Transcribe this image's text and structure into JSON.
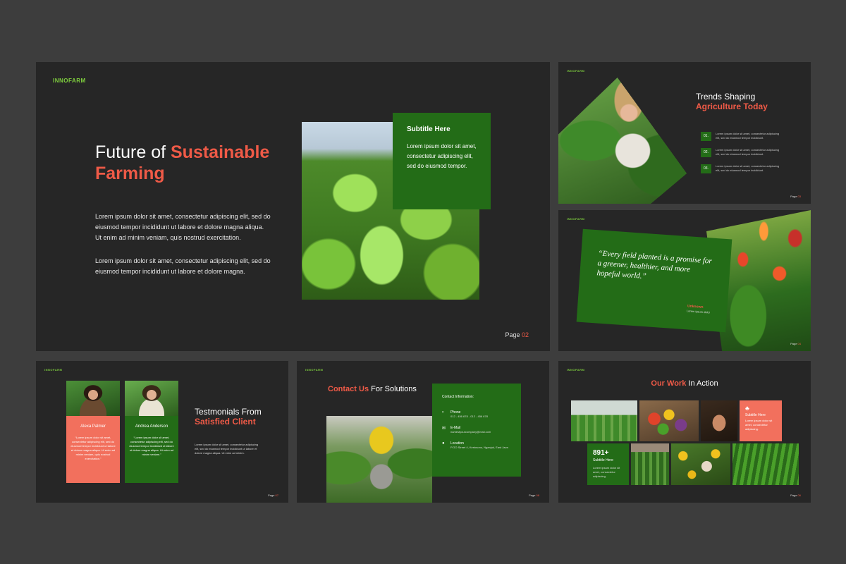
{
  "brand": "INNOFARM",
  "slide1": {
    "title_a": "Future of ",
    "title_b": "Sustainable",
    "title_c": "Farming",
    "para1": "Lorem ipsum dolor sit amet, consectetur adipiscing elit, sed do eiusmod tempor incididunt ut labore et dolore magna aliqua. Ut enim ad minim veniam, quis nostrud exercitation.",
    "para2": "Lorem ipsum dolor sit amet, consectetur adipiscing elit, sed do eiusmod tempor incididunt ut labore et dolore magna.",
    "box_title": "Subtitle Here",
    "box_text": "Lorem ipsum dolor sit amet, consectetur adipiscing elit, sed do eiusmod tempor.",
    "page_label": "Page ",
    "page_num": "02"
  },
  "slide2": {
    "title_a": "Trends Shaping",
    "title_b": "Agriculture Today",
    "items": [
      {
        "num": "01.",
        "text": "Lorem ipsum dolor sit amet, consectetur adipiscing elit, sed do eiusmod tempor incididunt."
      },
      {
        "num": "02.",
        "text": "Lorem ipsum dolor sit amet, consectetur adipiscing elit, sed do eiusmod tempor incididunt."
      },
      {
        "num": "03.",
        "text": "Lorem ipsum dolor sit amet, consectetur adipiscing elit, sed do eiusmod tempor incididunt."
      }
    ],
    "page_label": "Page ",
    "page_num": "03"
  },
  "slide3": {
    "quote": "“Every field planted is a promise for a greener, healthier, and more hopeful world.”",
    "author": "Unknown",
    "author_sub": "Lorem ipsum dolor",
    "page_label": "Page ",
    "page_num": "04"
  },
  "slide4": {
    "title_a": "Testmonials From",
    "title_b": "Satisfied Client",
    "text": "Lorem ipsum dolor sit amet, consectetur adipiscing elit, sed do eiusmod tempor incididunt ut labore et dolore magna aliqua. Ut enim ad minim.",
    "person1_name": "Alexa Palmer",
    "person1_text": "“Lorem ipsum dolor sit amet, consectetur adipiscing elit, sed do eiusmod tempor incididunt ut labore et dolore magna aliqua. Ut enim ad minim veniam, quis nostrud exercitation.”",
    "person2_name": "Andrea Anderson",
    "person2_text": "“Lorem ipsum dolor sit amet, consectetur adipiscing elit, sed do eiusmod tempor incididunt ut labore et dolore magna aliqua. Ut enim ad minim veniam.”",
    "page_label": "Page ",
    "page_num": "07"
  },
  "slide5": {
    "title_a": "Contact Us",
    "title_b": " For Solutions",
    "box_title": "Contact Information:",
    "phone_label": "Phone",
    "phone_value": "012 - 456 678 - 012 - 456 678",
    "email_label": "E-Mail",
    "email_value": "namestyourcompany@mail.com",
    "location_label": "Location",
    "location_value": "P.GO Street 4, Kertosono, Nganjuk, East Java",
    "page_label": "Page ",
    "page_num": "08"
  },
  "slide6": {
    "title_a": "Our Work",
    "title_b": " In Action",
    "stat_value": "891+",
    "stat_label": "Subtitle Here",
    "stat_text": "Lorem ipsum dolor sit amet, consectetur adipiscing.",
    "coral_title": "Subtitle Here",
    "coral_text": "Lorem ipsum dolor sit amet, consectetur adipiscing.",
    "page_label": "Page ",
    "page_num": "06"
  },
  "colors": {
    "background": "#3d3d3d",
    "slide": "#262626",
    "green": "#236c17",
    "coral": "#f2705d",
    "accent_text": "#ef5a47",
    "logo": "#7fcf3e"
  }
}
